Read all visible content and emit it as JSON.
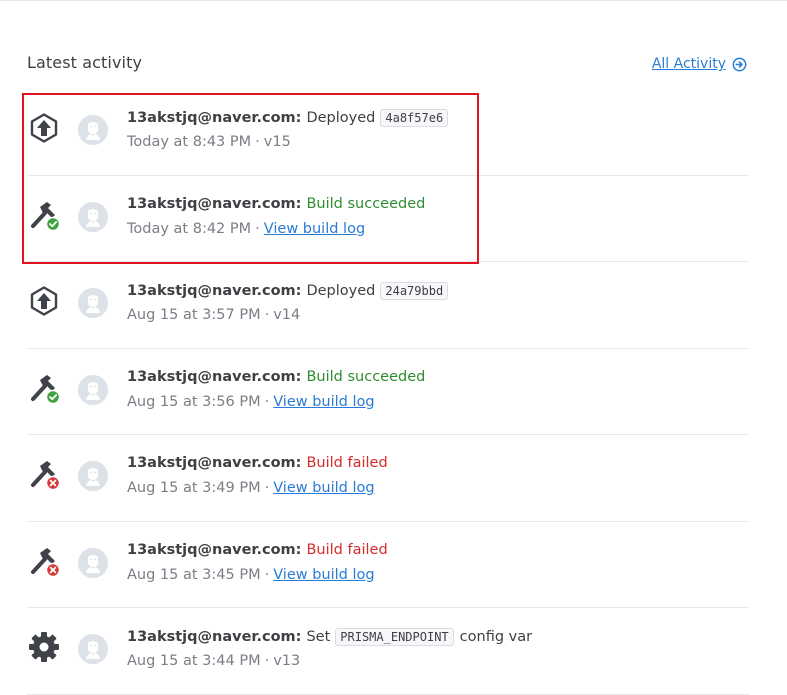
{
  "header": {
    "title": "Latest activity",
    "all_activity_label": "All Activity"
  },
  "colors": {
    "link": "#2a7bd6",
    "success": "#2f8d2f",
    "fail": "#d52b2b",
    "highlight": "#e0141e"
  },
  "activities": [
    {
      "icon": "deploy-icon",
      "user": "13akstjq@naver.com:",
      "action": "Deployed",
      "status": "neutral",
      "code": "4a8f57e6",
      "suffix": "",
      "time": "Today at 8:43 PM",
      "meta": "v15",
      "meta_is_link": false
    },
    {
      "icon": "build-success-icon",
      "user": "13akstjq@naver.com:",
      "action": "Build succeeded",
      "status": "success",
      "code": "",
      "suffix": "",
      "time": "Today at 8:42 PM",
      "meta": "View build log",
      "meta_is_link": true
    },
    {
      "icon": "deploy-icon",
      "user": "13akstjq@naver.com:",
      "action": "Deployed",
      "status": "neutral",
      "code": "24a79bbd",
      "suffix": "",
      "time": "Aug 15 at 3:57 PM",
      "meta": "v14",
      "meta_is_link": false
    },
    {
      "icon": "build-success-icon",
      "user": "13akstjq@naver.com:",
      "action": "Build succeeded",
      "status": "success",
      "code": "",
      "suffix": "",
      "time": "Aug 15 at 3:56 PM",
      "meta": "View build log",
      "meta_is_link": true
    },
    {
      "icon": "build-failed-icon",
      "user": "13akstjq@naver.com:",
      "action": "Build failed",
      "status": "fail",
      "code": "",
      "suffix": "",
      "time": "Aug 15 at 3:49 PM",
      "meta": "View build log",
      "meta_is_link": true
    },
    {
      "icon": "build-failed-icon",
      "user": "13akstjq@naver.com:",
      "action": "Build failed",
      "status": "fail",
      "code": "",
      "suffix": "",
      "time": "Aug 15 at 3:45 PM",
      "meta": "View build log",
      "meta_is_link": true
    },
    {
      "icon": "gear-icon",
      "user": "13akstjq@naver.com:",
      "action": "Set",
      "status": "neutral",
      "code": "PRISMA_ENDPOINT",
      "suffix": "config var",
      "time": "Aug 15 at 3:44 PM",
      "meta": "v13",
      "meta_is_link": false
    }
  ]
}
